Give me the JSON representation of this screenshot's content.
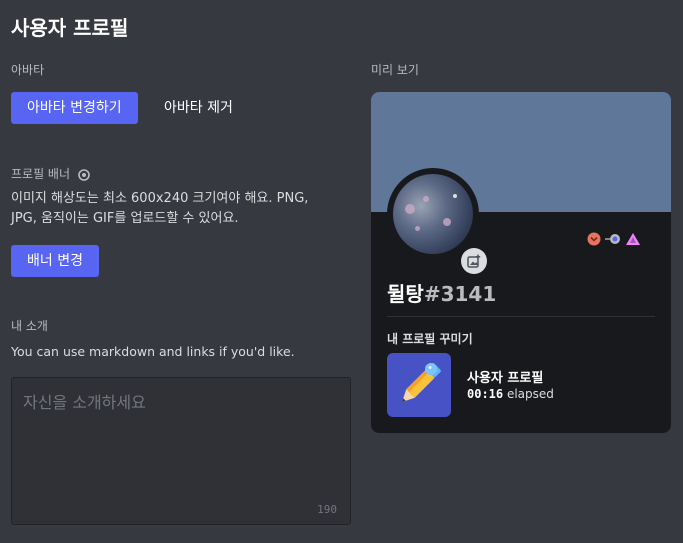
{
  "page": {
    "title": "사용자 프로필"
  },
  "avatar_section": {
    "label": "아바타",
    "change_button": "아바타 변경하기",
    "remove_button": "아바타 제거"
  },
  "banner_section": {
    "label": "프로필 배너",
    "help_line1": "이미지 해상도는 최소 600x240 크기여야 해요. PNG,",
    "help_line2": "JPG, 움직이는 GIF를 업로드할 수 있어요.",
    "change_button": "배너 변경"
  },
  "bio_section": {
    "label": "내 소개",
    "help": "You can use markdown and links if you'd like.",
    "placeholder": "자신을 소개하세요",
    "remaining": "190"
  },
  "preview": {
    "label": "미리 보기",
    "banner_color": "#5f7799",
    "username": "뒬탕",
    "discriminator": "#3141",
    "section_title": "내 프로필 꾸미기",
    "activity_name": "사용자 프로필",
    "activity_timer": "00:16",
    "activity_suffix": "elapsed",
    "badges": [
      "bug-hunter-icon",
      "nitro-icon",
      "hypesquad-icon"
    ]
  },
  "colors": {
    "accent": "#5865f2",
    "background": "#36393f",
    "card": "#18191c"
  }
}
